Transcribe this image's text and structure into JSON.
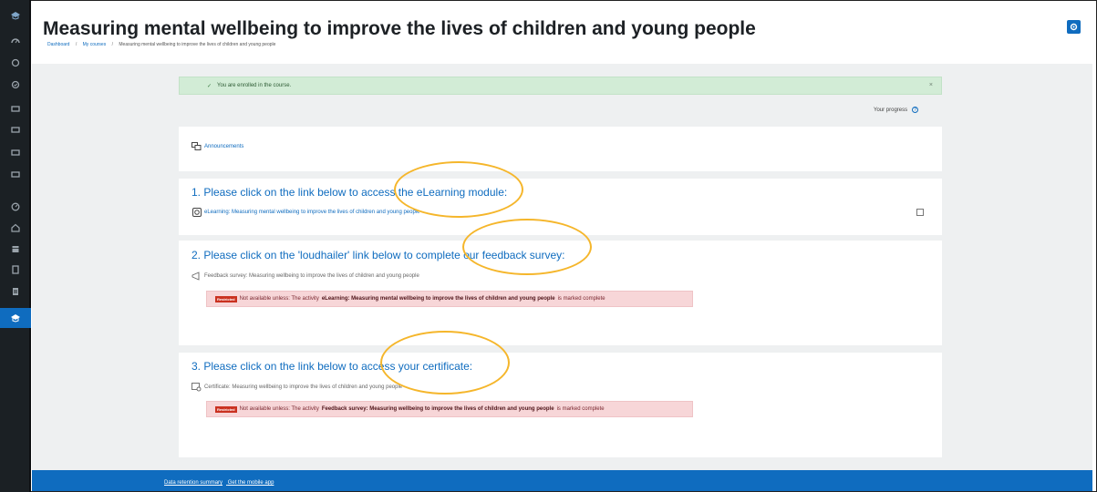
{
  "header": {
    "title": "Measuring mental wellbeing to improve the lives of children and young people",
    "breadcrumb": [
      "Dashboard",
      "My courses",
      "Measuring mental wellbeing to improve the lives of children and young people"
    ]
  },
  "alert": {
    "message": "You are enrolled in the course.",
    "close_symbol": "×"
  },
  "progress": {
    "label": "Your progress",
    "help_symbol": "?"
  },
  "announcements": {
    "label": "Announcements"
  },
  "sections": [
    {
      "heading": "1. Please click on the link below to access the eLearning module:",
      "activity": "eLearning: Measuring mental wellbeing to improve the lives of children and young people"
    },
    {
      "heading": "2. Please click on the 'loudhailer' link below to complete our feedback survey:",
      "activity": "Feedback survey: Measuring wellbeing to improve the lives of children and young people",
      "restriction": {
        "badge": "Restricted",
        "prefix": "Not available unless: The activity",
        "activity": "eLearning: Measuring mental wellbeing to improve the lives of children and young people",
        "suffix": "is marked complete"
      }
    },
    {
      "heading": "3. Please click on the link below to access your certificate:",
      "activity": "Certificate: Measuring wellbeing to improve the lives of children and young people",
      "restriction": {
        "badge": "Restricted",
        "prefix": "Not available unless: The activity",
        "activity": "Feedback survey: Measuring wellbeing to improve the lives of children and young people",
        "suffix": "is marked complete"
      }
    }
  ],
  "footer": {
    "links": [
      "Data retention summary",
      "Get the mobile app"
    ]
  },
  "colors": {
    "brand": "#0f6cbf",
    "rail": "#1b2024",
    "annotation": "#f5b62b",
    "success_bg": "#d2ecd6",
    "restricted_bg": "#f7d6d8"
  },
  "rail_icons": [
    "graduation-cap-icon",
    "tachometer-icon",
    "circle-icon",
    "check-circle-icon",
    "folder-icon",
    "folder-icon",
    "folder-icon",
    "folder-icon",
    "dashboard-icon",
    "home-icon",
    "calendar-icon",
    "file-icon",
    "files-icon",
    "graduation-cap-icon"
  ]
}
